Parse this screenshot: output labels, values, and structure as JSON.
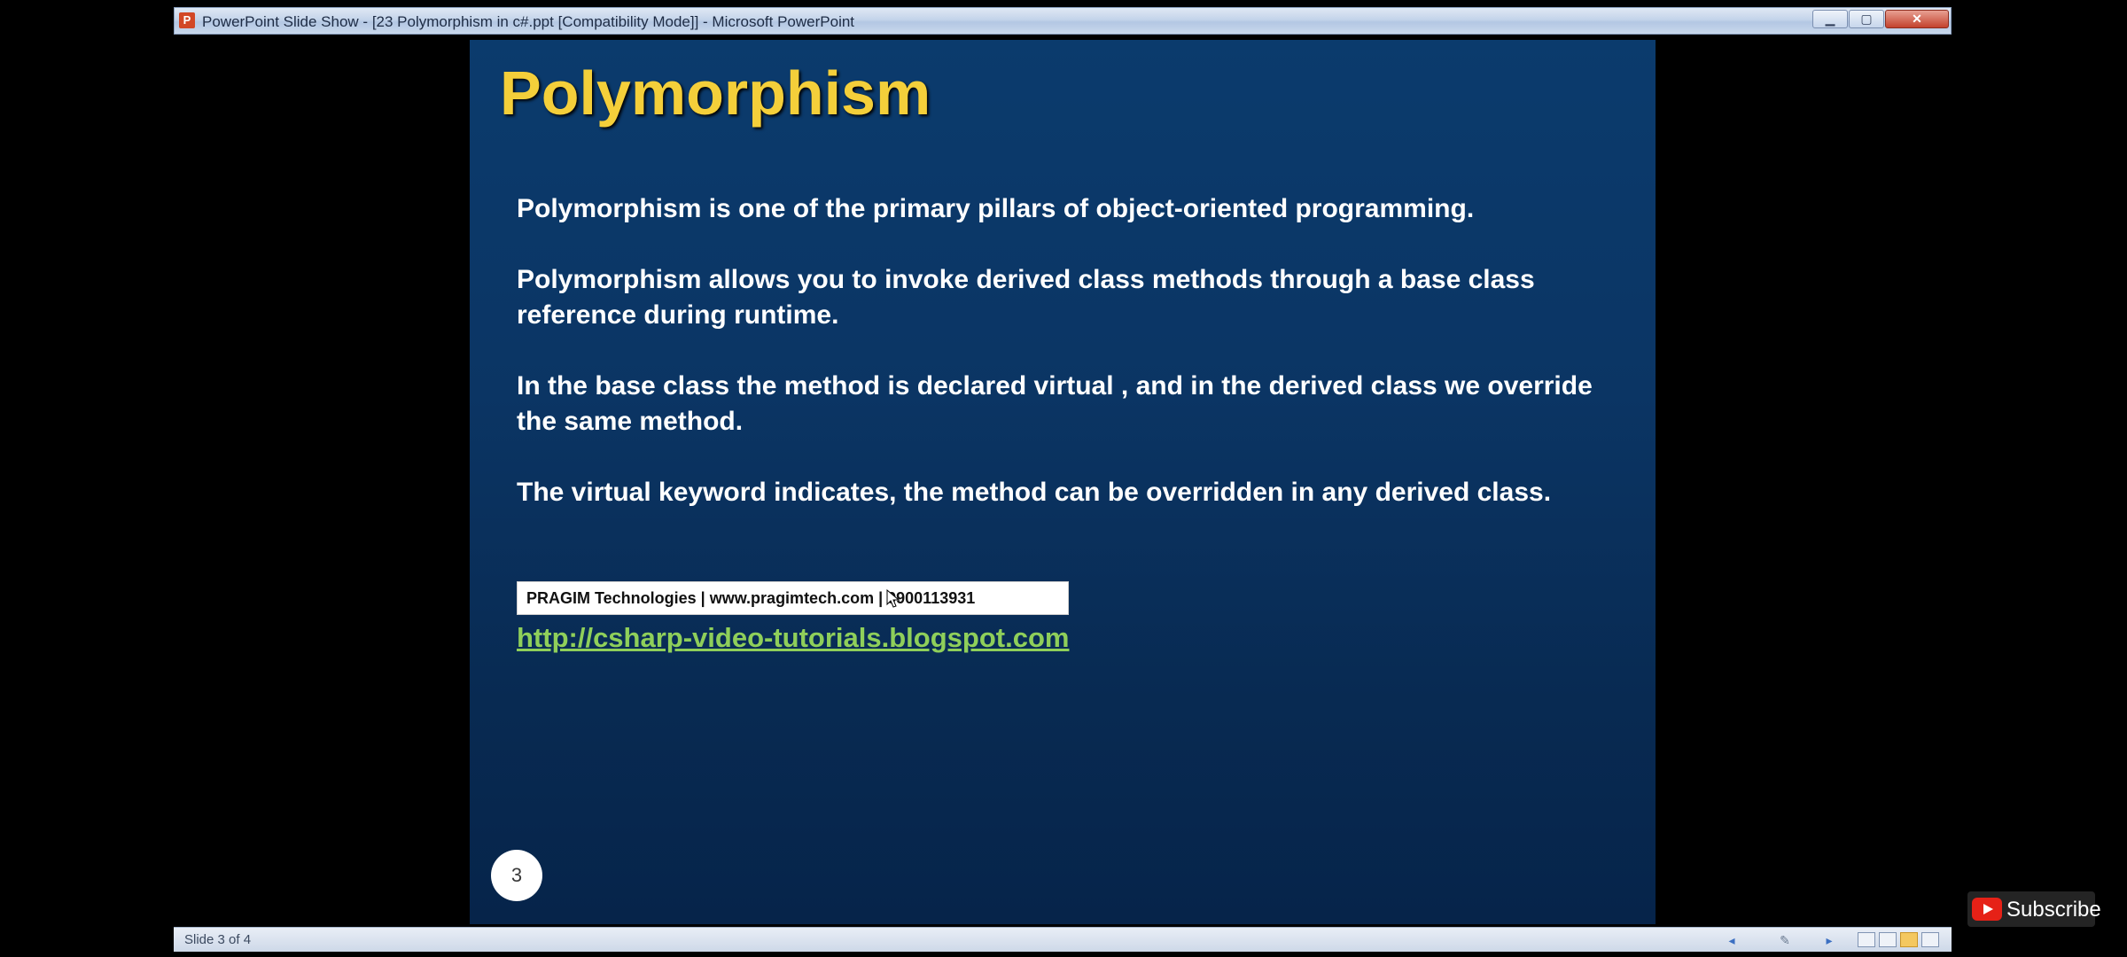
{
  "window": {
    "title": "PowerPoint Slide Show - [23 Polymorphism in c#.ppt [Compatibility Mode]] - Microsoft PowerPoint",
    "app_icon": "P",
    "minimize_label": "▁",
    "maximize_label": "▢",
    "close_label": "✕"
  },
  "slide": {
    "title": "Polymorphism",
    "bullets": [
      "Polymorphism is one of the primary pillars of object-oriented programming.",
      "Polymorphism allows you to invoke derived class methods through a base class reference during runtime.",
      "In the base class the method is declared virtual , and in the derived class we override the same method.",
      "The virtual keyword indicates, the method can be overridden in any derived class."
    ],
    "banner_text": "PRAGIM Technologies | www.pragimtech.com | 9900113931",
    "link_text": "http://csharp-video-tutorials.blogspot.com",
    "number": "3"
  },
  "statusbar": {
    "text": "Slide 3 of 4",
    "prev_icon": "◂",
    "pen_icon": "✎",
    "next_icon": "▸"
  },
  "subscribe": {
    "label": "Subscribe"
  },
  "colors": {
    "slide_bg": "#0b3b6d",
    "title": "#f4cf3a",
    "link": "#8fcf5a"
  }
}
